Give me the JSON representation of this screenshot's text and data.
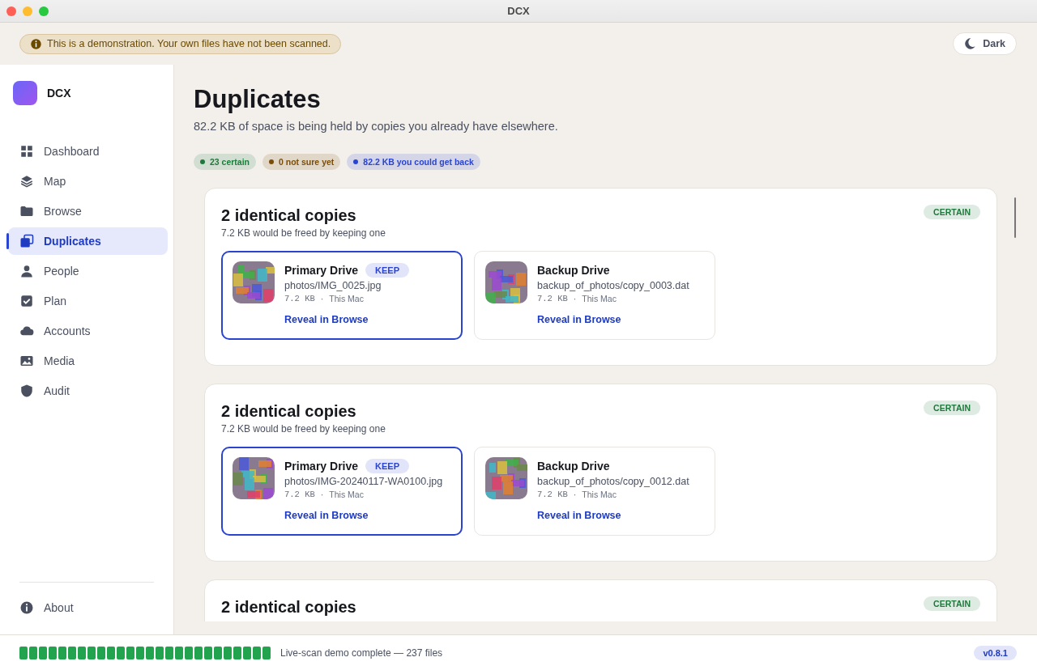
{
  "window": {
    "title": "DCX"
  },
  "banner": {
    "text": "This is a demonstration. Your own files have not been scanned.",
    "theme_button": "Dark"
  },
  "sidebar": {
    "app_name": "DCX",
    "items": [
      {
        "label": "Dashboard",
        "selected": false
      },
      {
        "label": "Map",
        "selected": false
      },
      {
        "label": "Browse",
        "selected": false
      },
      {
        "label": "Duplicates",
        "selected": true
      },
      {
        "label": "People",
        "selected": false
      },
      {
        "label": "Plan",
        "selected": false
      },
      {
        "label": "Accounts",
        "selected": false
      },
      {
        "label": "Media",
        "selected": false
      },
      {
        "label": "Audit",
        "selected": false
      }
    ],
    "footer_item": {
      "label": "About"
    }
  },
  "page": {
    "title": "Duplicates",
    "subtitle": "82.2 KB of space is being held by copies you already have elsewhere.",
    "chips": [
      {
        "text": "23 certain",
        "color": "#1e7a3c"
      },
      {
        "text": "0 not sure yet",
        "color": "#7a4d0a"
      },
      {
        "text": "82.2 KB you could get back",
        "color": "#2a44d0"
      }
    ],
    "groups": [
      {
        "title": "2 identical copies",
        "subtitle": "7.2 KB would be freed by keeping one",
        "badge": "CERTAIN",
        "copies": [
          {
            "drive": "Primary Drive",
            "tag": "KEEP",
            "selected": true,
            "path": "photos/IMG_0025.jpg",
            "size": "7.2 KB",
            "sep": "·",
            "location": "This Mac",
            "link": "Reveal in Browse"
          },
          {
            "drive": "Backup Drive",
            "selected": false,
            "path": "backup_of_photos/copy_0003.dat",
            "size": "7.2 KB",
            "sep": "·",
            "location": "This Mac",
            "link": "Reveal in Browse"
          }
        ]
      },
      {
        "title": "2 identical copies",
        "subtitle": "7.2 KB would be freed by keeping one",
        "badge": "CERTAIN",
        "copies": [
          {
            "drive": "Primary Drive",
            "tag": "KEEP",
            "selected": true,
            "path": "photos/IMG-20240117-WA0100.jpg",
            "size": "7.2 KB",
            "sep": "·",
            "location": "This Mac",
            "link": "Reveal in Browse"
          },
          {
            "drive": "Backup Drive",
            "selected": false,
            "path": "backup_of_photos/copy_0012.dat",
            "size": "7.2 KB",
            "sep": "·",
            "location": "This Mac",
            "link": "Reveal in Browse"
          }
        ]
      },
      {
        "title": "2 identical copies",
        "badge": "CERTAIN"
      }
    ]
  },
  "status_bar": {
    "progress": {
      "level": 1
    },
    "text": "Live-scan demo complete — 237 files",
    "version": "v0.8.1"
  }
}
